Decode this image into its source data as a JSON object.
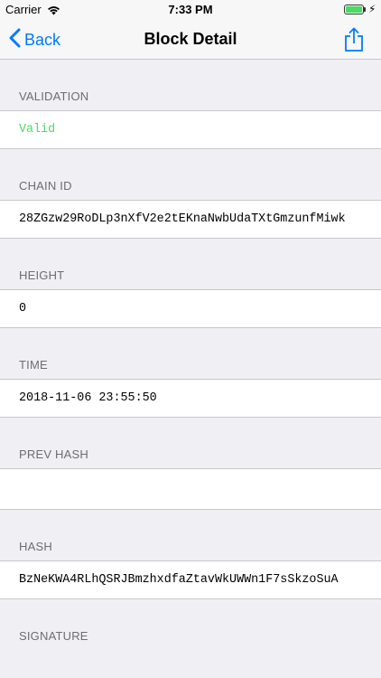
{
  "status_bar": {
    "carrier": "Carrier",
    "time": "7:33 PM",
    "battery_level": 1.0
  },
  "nav": {
    "back_label": "Back",
    "title": "Block Detail"
  },
  "sections": {
    "validation": {
      "header": "VALIDATION",
      "value": "Valid"
    },
    "chain_id": {
      "header": "CHAIN ID",
      "value": "28ZGzw29RoDLp3nXfV2e2tEKnaNwbUdaTXtGmzunfMiwk"
    },
    "height": {
      "header": "HEIGHT",
      "value": "0"
    },
    "time": {
      "header": "TIME",
      "value": "2018-11-06 23:55:50"
    },
    "prev_hash": {
      "header": "PREV HASH",
      "value": ""
    },
    "hash": {
      "header": "HASH",
      "value": "BzNeKWA4RLhQSRJBmzhxdfaZtavWkUWWn1F7sSkzoSuA"
    },
    "signature": {
      "header": "SIGNATURE"
    }
  },
  "colors": {
    "accent": "#007aff",
    "valid": "#4cd964",
    "background": "#efeff4"
  }
}
